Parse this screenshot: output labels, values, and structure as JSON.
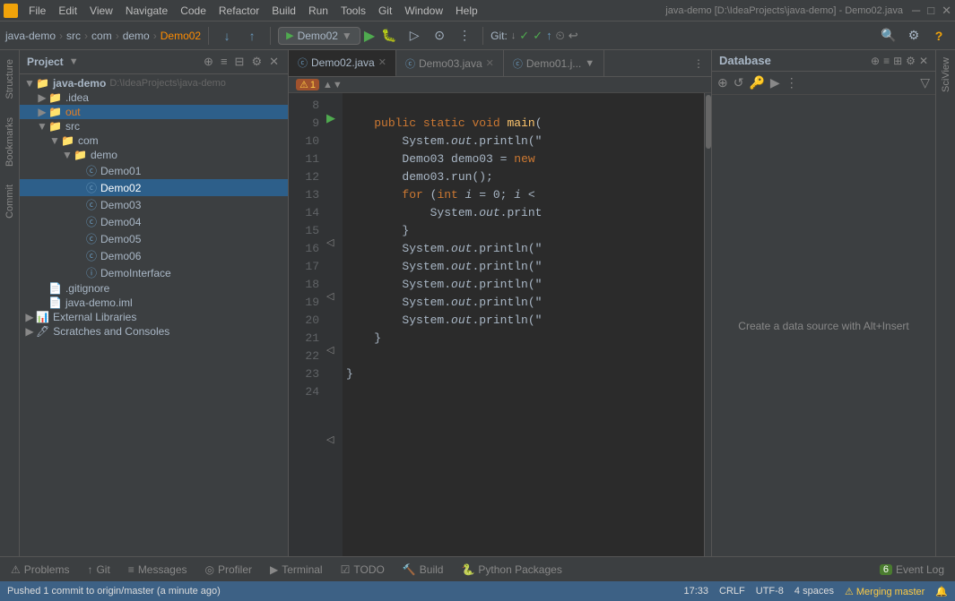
{
  "app": {
    "title": "java-demo [D:\\IdeaProjects\\java-demo] - Demo02.java",
    "icon_label": "IJ"
  },
  "menu": {
    "items": [
      "File",
      "Edit",
      "View",
      "Navigate",
      "Code",
      "Refactor",
      "Build",
      "Run",
      "Tools",
      "Git",
      "Window",
      "Help"
    ]
  },
  "toolbar": {
    "breadcrumbs": [
      "java-demo",
      "src",
      "com",
      "demo",
      "Demo02"
    ],
    "run_config": "Demo02",
    "git_label": "Git:",
    "search_icon": "🔍",
    "settings_icon": "⚙"
  },
  "project_panel": {
    "title": "Project",
    "root": "java-demo",
    "root_path": "D:\\IdeaProjects\\java-demo",
    "items": [
      {
        "id": "idea",
        "label": ".idea",
        "indent": 1,
        "type": "folder",
        "expanded": false
      },
      {
        "id": "out",
        "label": "out",
        "indent": 1,
        "type": "folder_orange",
        "expanded": false
      },
      {
        "id": "src",
        "label": "src",
        "indent": 1,
        "type": "folder",
        "expanded": true
      },
      {
        "id": "com",
        "label": "com",
        "indent": 2,
        "type": "folder",
        "expanded": true
      },
      {
        "id": "demo",
        "label": "demo",
        "indent": 3,
        "type": "folder",
        "expanded": true
      },
      {
        "id": "Demo01",
        "label": "Demo01",
        "indent": 4,
        "type": "class"
      },
      {
        "id": "Demo02",
        "label": "Demo02",
        "indent": 4,
        "type": "class",
        "selected": true
      },
      {
        "id": "Demo03",
        "label": "Demo03",
        "indent": 4,
        "type": "class"
      },
      {
        "id": "Demo04",
        "label": "Demo04",
        "indent": 4,
        "type": "class"
      },
      {
        "id": "Demo05",
        "label": "Demo05",
        "indent": 4,
        "type": "class"
      },
      {
        "id": "Demo06",
        "label": "Demo06",
        "indent": 4,
        "type": "class"
      },
      {
        "id": "DemoInterface",
        "label": "DemoInterface",
        "indent": 4,
        "type": "interface"
      },
      {
        "id": "gitignore",
        "label": ".gitignore",
        "indent": 1,
        "type": "file"
      },
      {
        "id": "iml",
        "label": "java-demo.iml",
        "indent": 1,
        "type": "file"
      },
      {
        "id": "ext-libs",
        "label": "External Libraries",
        "indent": 0,
        "type": "folder",
        "expanded": false
      },
      {
        "id": "scratches",
        "label": "Scratches and Consoles",
        "indent": 0,
        "type": "folder",
        "expanded": false
      }
    ]
  },
  "editor": {
    "tabs": [
      {
        "label": "Demo02.java",
        "active": true
      },
      {
        "label": "Demo03.java",
        "active": false
      },
      {
        "label": "Demo01.j...",
        "active": false
      }
    ],
    "breadcrumb": {
      "warning_count": "1",
      "nav_icon": "▲▼"
    },
    "lines": [
      {
        "num": 8,
        "content": ""
      },
      {
        "num": 9,
        "content": "    <run>public</run> <kw>static</kw> <kw>void</kw> <fn>main</fn>("
      },
      {
        "num": 10,
        "content": "        System.<sys>out</sys>.println(\""
      },
      {
        "num": 11,
        "content": "        Demo03 demo03 = <kw>new</kw>"
      },
      {
        "num": 12,
        "content": "        demo03.run();"
      },
      {
        "num": 13,
        "content": "        <kw>for</kw> (<kw>int</kw> <var>i</var> = 0; <var>i</var> <"
      },
      {
        "num": 14,
        "content": "            System.<sys>out</sys>.print"
      },
      {
        "num": 15,
        "content": "        }"
      },
      {
        "num": 16,
        "content": "        System.<sys>out</sys>.println(\""
      },
      {
        "num": 17,
        "content": "        System.<sys>out</sys>.println(\""
      },
      {
        "num": 18,
        "content": "        System.<sys>out</sys>.println(\""
      },
      {
        "num": 19,
        "content": "        System.<sys>out</sys>.println(\""
      },
      {
        "num": 20,
        "content": "        System.<sys>out</sys>.println(\""
      },
      {
        "num": 21,
        "content": "    }"
      },
      {
        "num": 22,
        "content": ""
      },
      {
        "num": 23,
        "content": "}"
      },
      {
        "num": 24,
        "content": ""
      }
    ]
  },
  "database_panel": {
    "title": "Database",
    "empty_text": "Create a data source with Alt+Insert"
  },
  "bottom_tabs": [
    {
      "label": "Problems",
      "icon": "⚠"
    },
    {
      "label": "Git",
      "icon": "↑"
    },
    {
      "label": "Messages",
      "icon": "≡"
    },
    {
      "label": "Profiler",
      "icon": "◎"
    },
    {
      "label": "Terminal",
      "icon": "▶"
    },
    {
      "label": "TODO",
      "icon": "☑"
    },
    {
      "label": "Build",
      "icon": "🔨"
    },
    {
      "label": "Python Packages",
      "icon": "🐍"
    },
    {
      "label": "Event Log",
      "icon": "6",
      "badge": "6"
    }
  ],
  "status_bar": {
    "push_status": "Pushed 1 commit to origin/master (a minute ago)",
    "time": "17:33",
    "line_ending": "CRLF",
    "encoding": "UTF-8",
    "indent": "4 spaces",
    "vcs_status": "⚠ Merging master",
    "notifications": "🔔"
  },
  "right_tabs": [
    {
      "label": "Database"
    },
    {
      "label": "SciView"
    }
  ],
  "left_tabs": [
    {
      "label": "Structure"
    },
    {
      "label": "Bookmarks"
    },
    {
      "label": "Commit"
    }
  ]
}
